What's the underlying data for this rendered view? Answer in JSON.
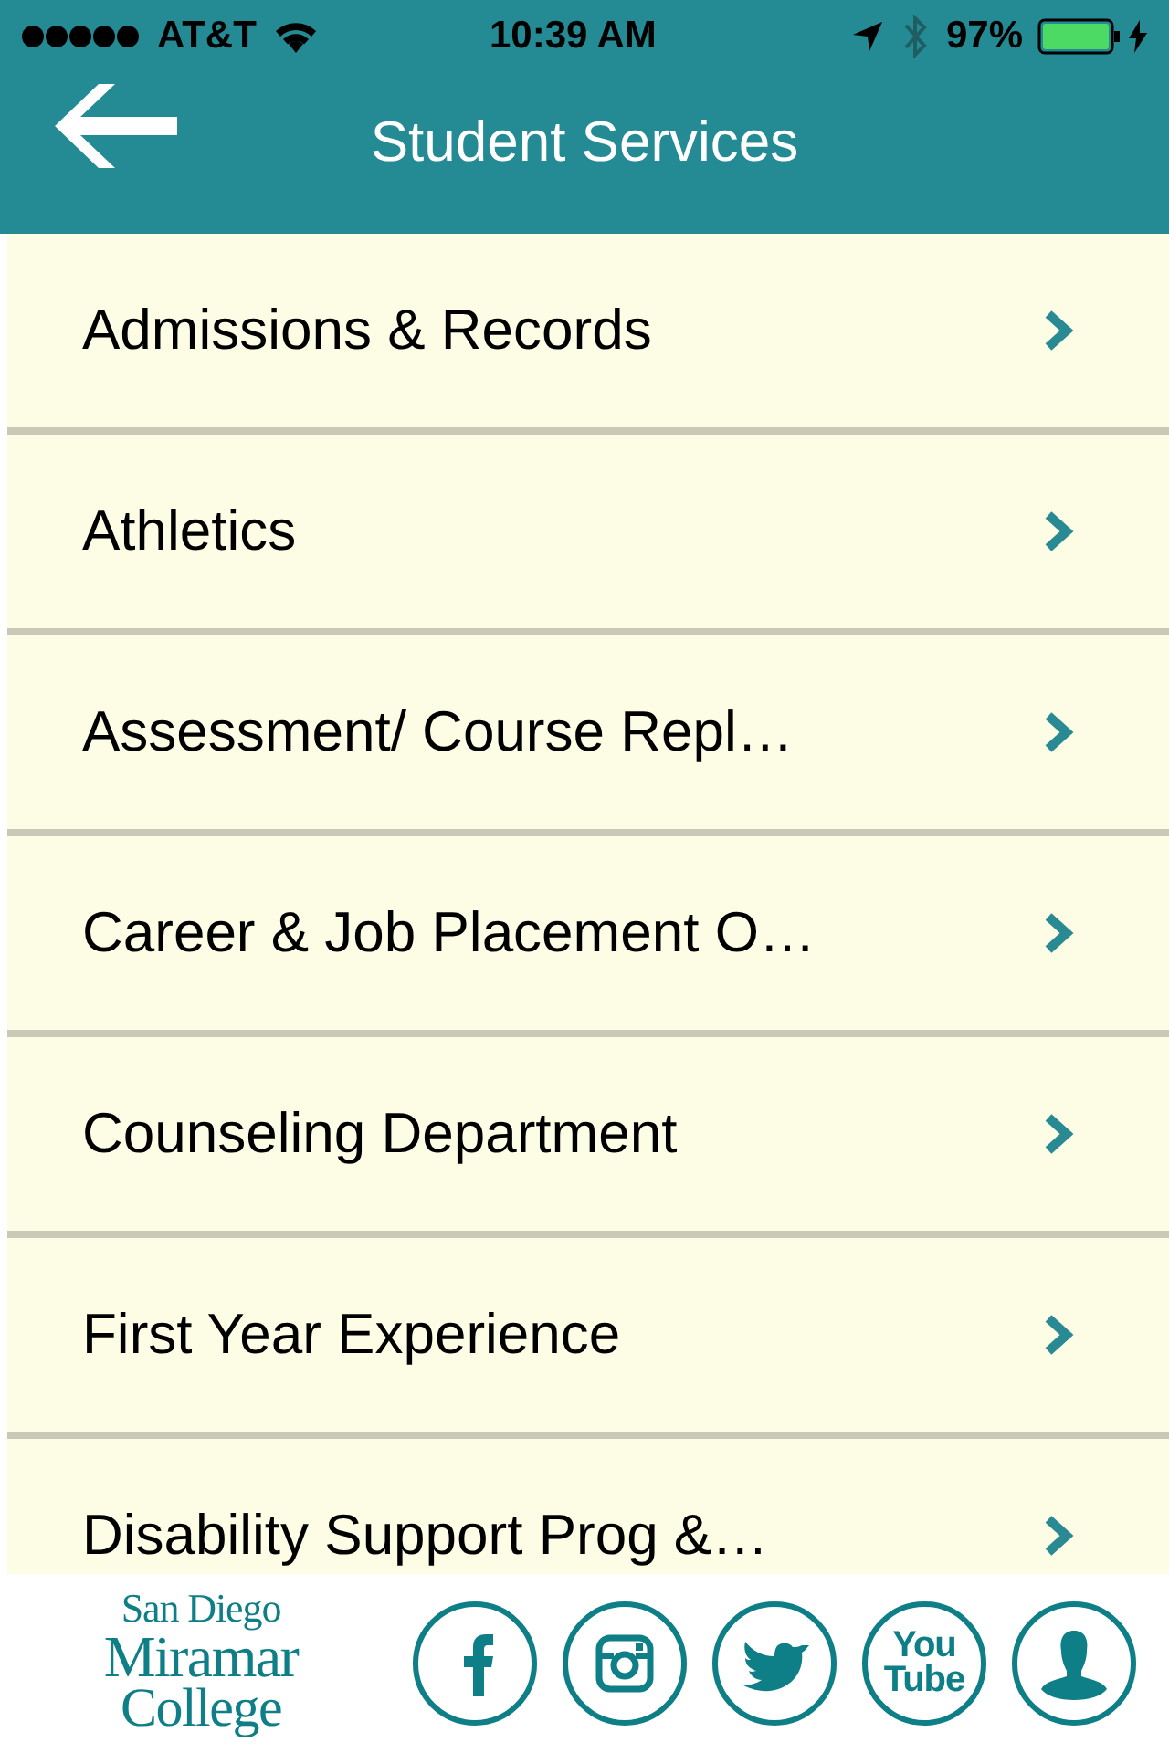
{
  "status_bar": {
    "carrier": "AT&T",
    "time": "10:39 AM",
    "battery": "97%"
  },
  "header": {
    "title": "Student Services"
  },
  "items": [
    {
      "label": "Admissions & Records"
    },
    {
      "label": "Athletics"
    },
    {
      "label": "Assessment/ Course Repl…"
    },
    {
      "label": "Career & Job Placement O…"
    },
    {
      "label": "Counseling Department"
    },
    {
      "label": "First Year Experience"
    },
    {
      "label": "Disability Support Prog &…"
    }
  ],
  "footer": {
    "logo": [
      "San Diego",
      "Miramar",
      "College"
    ],
    "social": [
      {
        "kind": "facebook"
      },
      {
        "kind": "instagram"
      },
      {
        "kind": "twitter"
      },
      {
        "kind": "youtube",
        "text": [
          "You",
          "Tube"
        ]
      },
      {
        "kind": "profile"
      }
    ]
  }
}
